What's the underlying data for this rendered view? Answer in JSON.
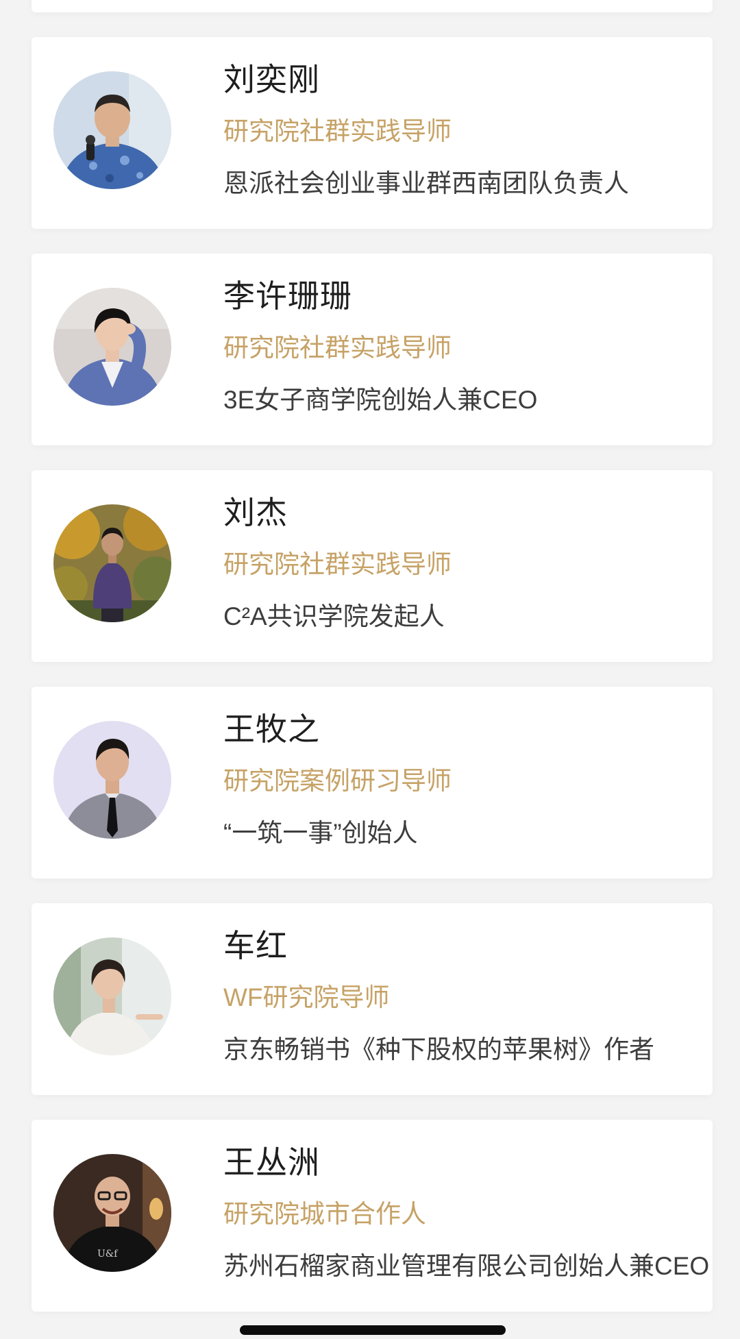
{
  "mentors": [
    {
      "name": "刘奕刚",
      "role": "研究院社群实践导师",
      "desc": "恩派社会创业事业群西南团队负责人",
      "avatar": "portrait-man-blue-patterned-shirt-microphone"
    },
    {
      "name": "李许珊珊",
      "role": "研究院社群实践导师",
      "desc": "3E女子商学院创始人兼CEO",
      "avatar": "portrait-woman-blue-blazer"
    },
    {
      "name": "刘杰",
      "role": "研究院社群实践导师",
      "desc": "C²A共识学院发起人",
      "avatar": "portrait-man-purple-jacket-autumn-trees"
    },
    {
      "name": "王牧之",
      "role": "研究院案例研习导师",
      "desc": "“一筑一事”创始人",
      "avatar": "portrait-man-grey-shirt-black-tie"
    },
    {
      "name": "车红",
      "role": "WF研究院导师",
      "desc": "京东畅销书《种下股权的苹果树》作者",
      "avatar": "portrait-woman-white-blouse-window"
    },
    {
      "name": "王丛洲",
      "role": "研究院城市合作人",
      "desc": "苏州石榴家商业管理有限公司创始人兼CEO",
      "avatar": "portrait-bald-man-glasses-black-tshirt"
    }
  ],
  "colors": {
    "background": "#f3f3f3",
    "card": "#ffffff",
    "name_text": "#1e1e1e",
    "role_gold": "#c6a266",
    "desc_text": "#3d3d3d"
  }
}
